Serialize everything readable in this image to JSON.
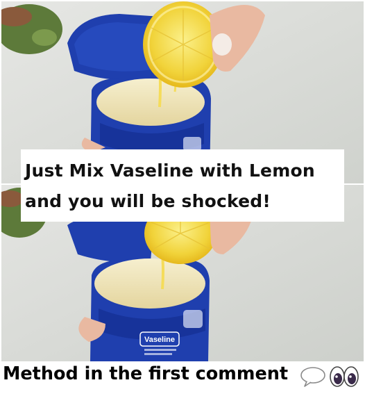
{
  "caption": {
    "line1": "Just Mix Vaseline with Lemon",
    "line2": "and you will be shocked!"
  },
  "jar": {
    "brand": "Vaseline"
  },
  "footer": {
    "text": "Method in the first comment",
    "icons": [
      "speech-bubble-icon",
      "eyes-icon"
    ]
  },
  "colors": {
    "jar_blue": "#1f3fae",
    "lemon_yellow": "#f3d53b",
    "petroleum_jelly": "#f1e7bf",
    "background": "#d9dcd8"
  }
}
